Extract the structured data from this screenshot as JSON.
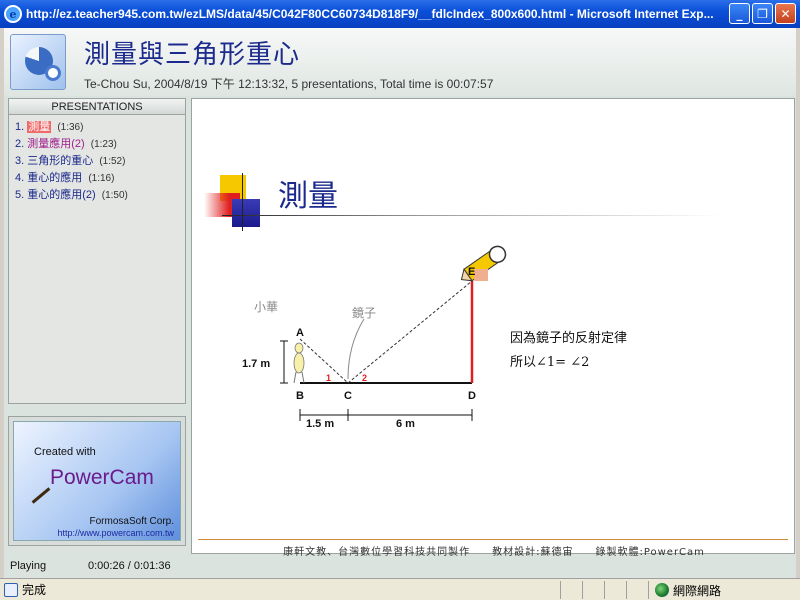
{
  "window": {
    "title": "http://ez.teacher945.com.tw/ezLMS/data/45/C042F80CC60734D818F9/__fdlcIndex_800x600.html - Microsoft Internet Exp...",
    "minimize": "_",
    "maximize": "❐",
    "close": "✕"
  },
  "header": {
    "title": "測量與三角形重心",
    "subtitle": "Te-Chou Su, 2004/8/19 下午 12:13:32, 5 presentations, Total time is 00:07:57"
  },
  "presentations": {
    "heading": "PRESENTATIONS",
    "items": [
      {
        "num": "1.",
        "name": "測量",
        "duration": "(1:36)",
        "state": "active"
      },
      {
        "num": "2.",
        "name": "測量應用(2)",
        "duration": "(1:23)",
        "state": "visited"
      },
      {
        "num": "3.",
        "name": "三角形的重心",
        "duration": "(1:52)",
        "state": "normal"
      },
      {
        "num": "4.",
        "name": "重心的應用",
        "duration": "(1:16)",
        "state": "normal"
      },
      {
        "num": "5.",
        "name": "重心的應用(2)",
        "duration": "(1:50)",
        "state": "normal"
      }
    ]
  },
  "promo": {
    "created_with": "Created with",
    "brand": "PowerCam",
    "company": "FormosaSoft Corp.",
    "url": "http://www.powercam.com.tw"
  },
  "slide": {
    "title": "測量",
    "labels": {
      "person": "小華",
      "mirror": "鏡子",
      "A": "A",
      "B": "B",
      "C": "C",
      "D": "D",
      "E": "E",
      "angle1": "1",
      "angle2": "2",
      "height": "1.7 m",
      "dist_bc": "1.5 m",
      "dist_cd": "6 m"
    },
    "caption_line1": "因為鏡子的反射定律",
    "caption_line2": "所以∠1= ∠2",
    "footer": "康軒文教、台灣數位學習科技共同製作　　教材設計:蘇德宙　　錄製軟體:PowerCam"
  },
  "status": {
    "state": "Playing",
    "time": "0:00:26 / 0:01:36"
  },
  "browser_status": {
    "text": "完成",
    "zone": "網際網路"
  },
  "colors": {
    "title_blue": "#1b2a8c",
    "accent_red": "#e02020",
    "active_item": "#f06a6a"
  }
}
